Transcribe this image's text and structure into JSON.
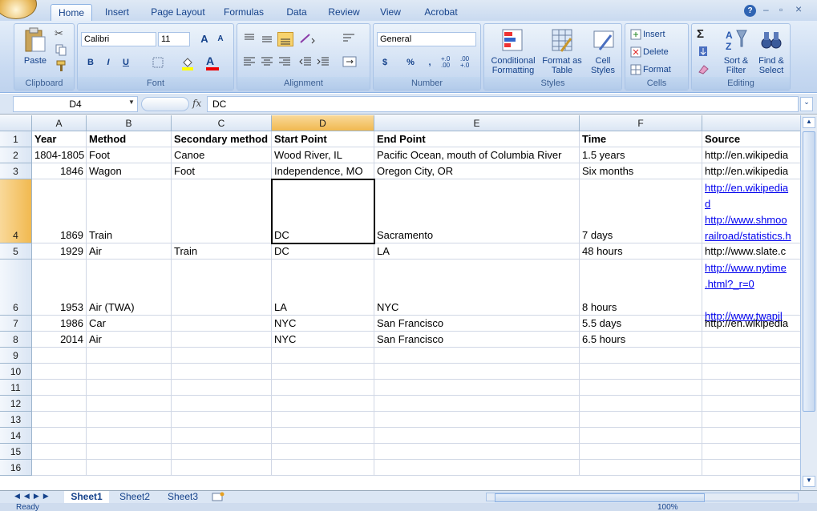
{
  "tabs": [
    "Home",
    "Insert",
    "Page Layout",
    "Formulas",
    "Data",
    "Review",
    "View",
    "Acrobat"
  ],
  "active_tab": "Home",
  "window_controls": {
    "help": "?",
    "minimize": "–",
    "restore": "▫",
    "close": "×"
  },
  "ribbon": {
    "clipboard": {
      "label": "Clipboard",
      "paste": "Paste"
    },
    "font": {
      "label": "Font",
      "font_name": "Calibri",
      "font_size": "11",
      "bold": "B",
      "italic": "I",
      "underline": "U",
      "grow": "A",
      "shrink": "A",
      "font_color": "A"
    },
    "alignment": {
      "label": "Alignment"
    },
    "number": {
      "label": "Number",
      "format": "General",
      "currency": "$",
      "percent": "%",
      "comma": ",",
      "inc_decimal": "+.0 .00",
      "dec_decimal": ".00 +.0"
    },
    "styles": {
      "label": "Styles",
      "conditional": "Conditional Formatting",
      "format_table": "Format as Table",
      "cell_styles": "Cell Styles"
    },
    "cells": {
      "label": "Cells",
      "insert": "Insert",
      "delete": "Delete",
      "format": "Format"
    },
    "editing": {
      "label": "Editing",
      "sum": "Σ",
      "sort": "Sort & Filter",
      "find": "Find & Select"
    }
  },
  "formula_bar": {
    "name_box": "D4",
    "fx": "fx",
    "value": "DC"
  },
  "columns": [
    "A",
    "B",
    "C",
    "D",
    "E",
    "F"
  ],
  "selected_column": "D",
  "selected_row": "4",
  "rows": [
    {
      "n": "1",
      "cells": [
        "Year",
        "Method",
        "Secondary method",
        "Start Point",
        "End Point",
        "Time",
        "Source"
      ]
    },
    {
      "n": "2",
      "cells": [
        "1804-1805",
        "Foot",
        "Canoe",
        "Wood River, IL",
        "Pacific Ocean, mouth of Columbia River",
        "1.5 years",
        "http://en.wikipedia"
      ]
    },
    {
      "n": "3",
      "cells": [
        "1846",
        "Wagon",
        "Foot",
        "Independence, MO",
        "Oregon City, OR",
        "Six months",
        "http://en.wikipedia"
      ]
    },
    {
      "n": "4",
      "cells": [
        "1869",
        "Train",
        "",
        "DC",
        "Sacramento",
        "7 days",
        ""
      ],
      "links": [
        "http://en.wikipedia",
        "d",
        "http://www.shmoo",
        "railroad/statistics.h"
      ]
    },
    {
      "n": "5",
      "cells": [
        "1929",
        "Air",
        "Train",
        "DC",
        "LA",
        "48 hours",
        "http://www.slate.c"
      ]
    },
    {
      "n": "6",
      "cells": [
        "1953",
        "Air (TWA)",
        "",
        "LA",
        "NYC",
        "8 hours",
        ""
      ],
      "links": [
        "http://www.nytime",
        ".html?_r=0",
        "",
        "http://www.twapil"
      ]
    },
    {
      "n": "7",
      "cells": [
        "1986",
        "Car",
        "",
        "NYC",
        "San Francisco",
        "5.5 days",
        "http://en.wikipedia"
      ]
    },
    {
      "n": "8",
      "cells": [
        "2014",
        "Air",
        "",
        "NYC",
        "San Francisco",
        "6.5 hours",
        ""
      ]
    },
    {
      "n": "9",
      "cells": [
        "",
        "",
        "",
        "",
        "",
        "",
        ""
      ]
    },
    {
      "n": "10",
      "cells": [
        "",
        "",
        "",
        "",
        "",
        "",
        ""
      ]
    },
    {
      "n": "11",
      "cells": [
        "",
        "",
        "",
        "",
        "",
        "",
        ""
      ]
    },
    {
      "n": "12",
      "cells": [
        "",
        "",
        "",
        "",
        "",
        "",
        ""
      ]
    },
    {
      "n": "13",
      "cells": [
        "",
        "",
        "",
        "",
        "",
        "",
        ""
      ]
    },
    {
      "n": "14",
      "cells": [
        "",
        "",
        "",
        "",
        "",
        "",
        ""
      ]
    },
    {
      "n": "15",
      "cells": [
        "",
        "",
        "",
        "",
        "",
        "",
        ""
      ]
    },
    {
      "n": "16",
      "cells": [
        "",
        "",
        "",
        "",
        "",
        "",
        ""
      ]
    }
  ],
  "sheets": [
    "Sheet1",
    "Sheet2",
    "Sheet3"
  ],
  "active_sheet": "Sheet1",
  "status": {
    "left": "Ready",
    "zoom": "100%"
  }
}
